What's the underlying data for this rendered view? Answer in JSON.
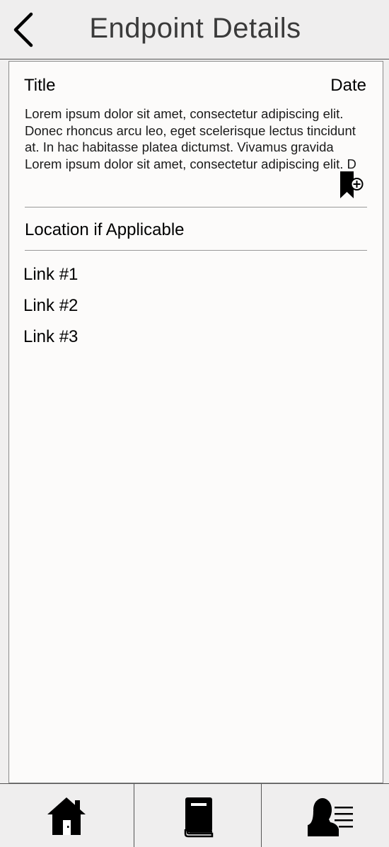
{
  "header": {
    "title": "Endpoint Details",
    "back_icon": "chevron-left-icon"
  },
  "entry": {
    "title": "Title",
    "date": "Date",
    "body": "Lorem ipsum dolor sit amet, consectetur adipiscing elit. Donec rhoncus arcu leo, eget scelerisque lectus tincidunt at. In hac habitasse platea dictumst. Vivamus gravida Lorem ipsum dolor sit amet, consectetur adipiscing elit. D",
    "bookmark_icon": "bookmark-add-icon"
  },
  "location": {
    "label": "Location if Applicable"
  },
  "links": [
    {
      "label": "Link #1"
    },
    {
      "label": "Link #2"
    },
    {
      "label": "Link #3"
    }
  ],
  "bottom_nav": {
    "items": [
      {
        "icon": "home-icon"
      },
      {
        "icon": "book-icon"
      },
      {
        "icon": "profile-icon"
      }
    ]
  }
}
